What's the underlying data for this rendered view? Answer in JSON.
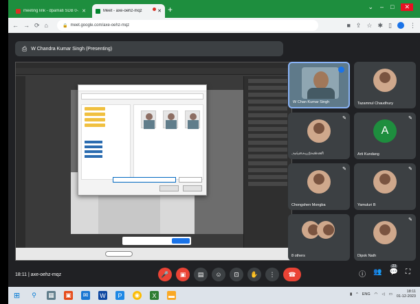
{
  "browser": {
    "tabs": [
      {
        "title": "meeting link - dpamati SDB 0-7",
        "active": false
      },
      {
        "title": "Meet - axe-oehz-mqz",
        "active": true
      }
    ],
    "url": "meet.google.com/axe-oehz-mqz"
  },
  "meet": {
    "presenter_label": "W Chandra Kumar Singh (Presenting)",
    "time": "18:11",
    "meeting_code": "axe-oehz-mqz",
    "participants": [
      {
        "name": "W Chan Kumar Singh",
        "type": "camera",
        "speaking": true
      },
      {
        "name": "Tazamnul Chaudhury",
        "type": "photo"
      },
      {
        "name": "அங்கையற்கண்ணி",
        "type": "photo"
      },
      {
        "name": "Arti Kundang",
        "type": "letter",
        "initial": "A"
      },
      {
        "name": "Chongshen Mongba",
        "type": "photo"
      },
      {
        "name": "Yamuluri B",
        "type": "photo"
      },
      {
        "name": "8 others",
        "type": "group"
      },
      {
        "name": "Dipok Nath",
        "type": "photo"
      }
    ],
    "people_count": "23"
  },
  "colors": {
    "accent": "#1a73e8",
    "danger": "#ea4335",
    "tabstrip": "#1e8e3e",
    "meet_bg": "#202124"
  },
  "taskbar": {
    "clock_time": "18:11",
    "clock_date": "01-12-2023",
    "lang": "ENG"
  }
}
